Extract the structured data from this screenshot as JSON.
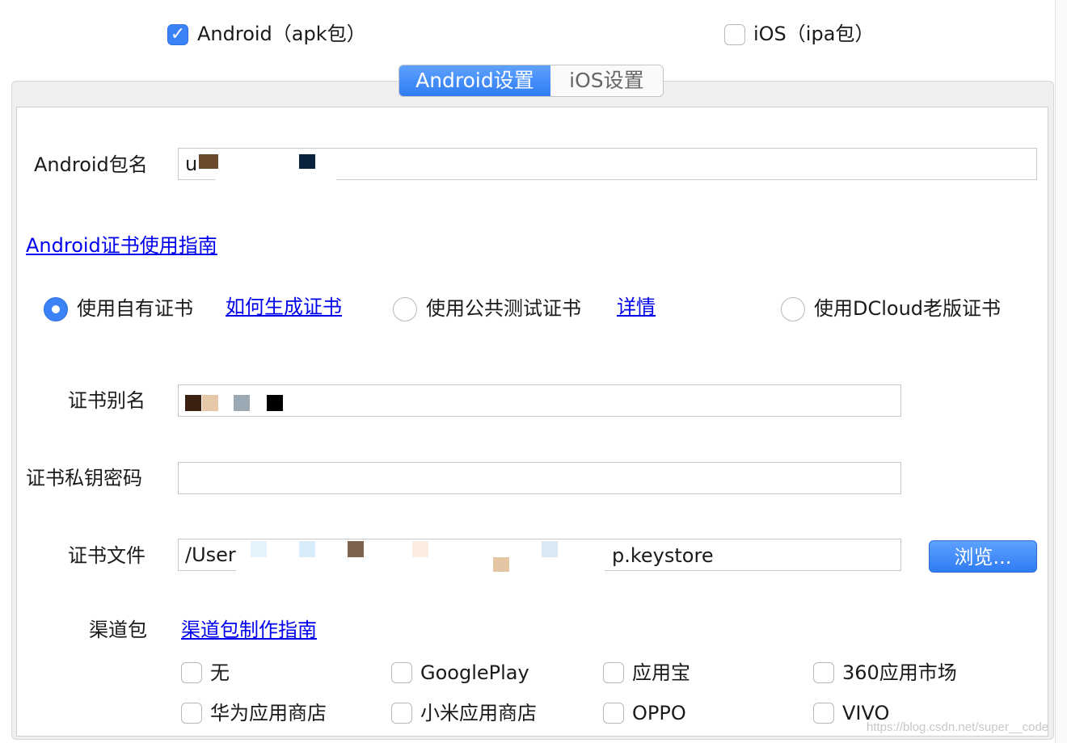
{
  "platforms": {
    "android": {
      "label": "Android（apk包）",
      "checked": true
    },
    "ios": {
      "label": "iOS（ipa包）",
      "checked": false
    }
  },
  "tabs": [
    {
      "label": "Android设置",
      "active": true
    },
    {
      "label": "iOS设置",
      "active": false
    }
  ],
  "package": {
    "label": "Android包名",
    "value": "u"
  },
  "cert_guide_link": "Android证书使用指南",
  "cert_options": [
    {
      "label": "使用自有证书",
      "selected": true,
      "link": "如何生成证书"
    },
    {
      "label": "使用公共测试证书",
      "selected": false,
      "link": "详情"
    },
    {
      "label": "使用DCloud老版证书",
      "selected": false
    }
  ],
  "cert_alias": {
    "label": "证书别名",
    "value": ""
  },
  "cert_password": {
    "label": "证书私钥密码",
    "value": ""
  },
  "cert_file": {
    "label": "证书文件",
    "value_prefix": "/User",
    "value_suffix": "p.keystore",
    "browse_label": "浏览..."
  },
  "channel": {
    "label": "渠道包",
    "guide_link": "渠道包制作指南",
    "items": [
      {
        "label": "无",
        "checked": false
      },
      {
        "label": "GooglePlay",
        "checked": false
      },
      {
        "label": "应用宝",
        "checked": false
      },
      {
        "label": "360应用市场",
        "checked": false
      },
      {
        "label": "华为应用商店",
        "checked": false
      },
      {
        "label": "小米应用商店",
        "checked": false
      },
      {
        "label": "OPPO",
        "checked": false
      },
      {
        "label": "VIVO",
        "checked": false
      }
    ]
  },
  "watermark": "https://blog.csdn.net/super__code",
  "icons": {
    "check": "checkmark-icon"
  },
  "colors": {
    "accent": "#3b82f6",
    "link": "#0000ee"
  }
}
